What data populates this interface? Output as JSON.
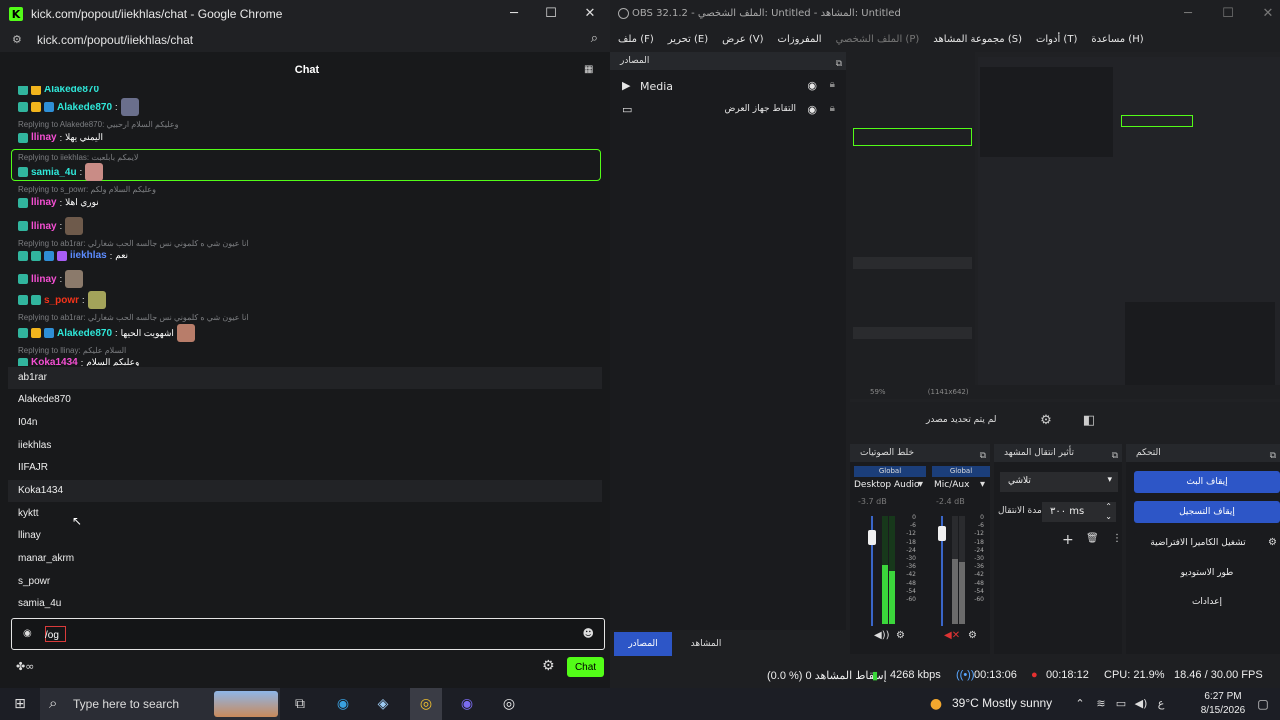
{
  "chrome": {
    "title": "kick.com/popout/iiekhlas/chat - Google Chrome",
    "url": "kick.com/popout/iiekhlas/chat"
  },
  "chat": {
    "header": "Chat",
    "messages": [
      {
        "user": "Alakede870",
        "text": "",
        "color": "#2fe7d9"
      },
      {
        "reply": "Replying to Alakede870: وعليكم السلام ارحبيي"
      },
      {
        "user": "llinay",
        "text": "اليمني يهلا",
        "color": "#f54fd3"
      },
      {
        "reply": "Replying to iiekhlas: لايمكم بابلعبت"
      },
      {
        "user": "samia_4u",
        "text": "",
        "color": "#2fe7d9"
      },
      {
        "reply": "Replying to s_powr: وعليكم السلام ولكم"
      },
      {
        "user": "llinay",
        "text": "نوري اهلا",
        "color": "#f54fd3"
      },
      {
        "user": "llinay",
        "text": "",
        "color": "#f54fd3"
      },
      {
        "reply": "Replying to ab1rar: انا عيون شي ه كلموني نس جالسه الحب شغارلي"
      },
      {
        "user": "iiekhlas",
        "text": "نعم",
        "color": "#5c8cff"
      },
      {
        "user": "llinay",
        "text": "",
        "color": "#f54fd3"
      },
      {
        "user": "s_powr",
        "text": "",
        "color": "#f5331a"
      },
      {
        "reply": "Replying to ab1rar: انا عيون شي ه كلموني نس جالسه الحب شغارلي"
      },
      {
        "user": "Alakede870",
        "text": "اشهويت الحيها",
        "color": "#2fe7d9"
      },
      {
        "reply": "Replying to llinay: السلام عليكم"
      },
      {
        "user": "Koka1434",
        "text": "وعليكم السلام",
        "color": "#f54fd3"
      }
    ],
    "users": [
      "ab1rar",
      "Alakede870",
      "I04n",
      "iiekhlas",
      "IIFAJR",
      "Koka1434",
      "kyktt",
      "llinay",
      "manar_akrm",
      "s_powr",
      "samia_4u"
    ],
    "input_value": "/og",
    "send_label": "Chat"
  },
  "obs": {
    "title": "OBS 32.1.2 - الملف الشخصي: Untitled - المشاهد: Untitled",
    "menu": [
      "ملف (F)",
      "تحرير (E)",
      "عرض (V)",
      "المفروزات",
      "الملف الشخصي (P)",
      "مجموعة المشاهد (S)",
      "أدوات (T)",
      "مساعدة (H)"
    ],
    "sources_title": "المصادر",
    "sources": [
      {
        "name": "Media",
        "icon": "play-icon"
      },
      {
        "name": "التقاط جهاز العرض",
        "icon": "monitor-icon"
      }
    ],
    "no_source": "لم يتم تحديد مصدر",
    "mixer": {
      "title": "خلط الصوتيات",
      "channels": [
        {
          "name": "Desktop Audio",
          "track": "Global",
          "db": "-3.7 dB",
          "level": 0.55
        },
        {
          "name": "Mic/Aux",
          "track": "Global",
          "db": "-2.4 dB",
          "level": 0.6
        }
      ],
      "scale": [
        "0",
        "-6",
        "-12",
        "-18",
        "-24",
        "-30",
        "-36",
        "-42",
        "-48",
        "-54",
        "-60"
      ]
    },
    "transitions": {
      "title": "تأثير انتقال المشهد",
      "type": "تلاشي",
      "duration_label": "مدة الانتقال",
      "duration_value": "٣٠٠ ms"
    },
    "controls": {
      "title": "التحكم",
      "buttons": [
        "إيقاف البث",
        "إيقاف التسجيل",
        "تشغيل الكاميرا الافتراضية",
        "طور الاستوديو",
        "إعدادات"
      ]
    },
    "tabs": [
      "المصادر",
      "المشاهد"
    ],
    "status": {
      "dropped": "(0.0 %) إسقاط المشاهد 0",
      "bitrate": "4268 kbps",
      "stream_time": "00:13:06",
      "rec_time": "00:18:12",
      "cpu": "CPU: 21.9%",
      "fps": "18.46 / 30.00 FPS"
    },
    "preview_readout": "59%",
    "preview_size": "(1141x642)"
  },
  "taskbar": {
    "search_placeholder": "Type here to search",
    "weather": "39°C  Mostly sunny",
    "time": "6:27 PM",
    "date": "8/15/2026",
    "lang": "ع"
  }
}
